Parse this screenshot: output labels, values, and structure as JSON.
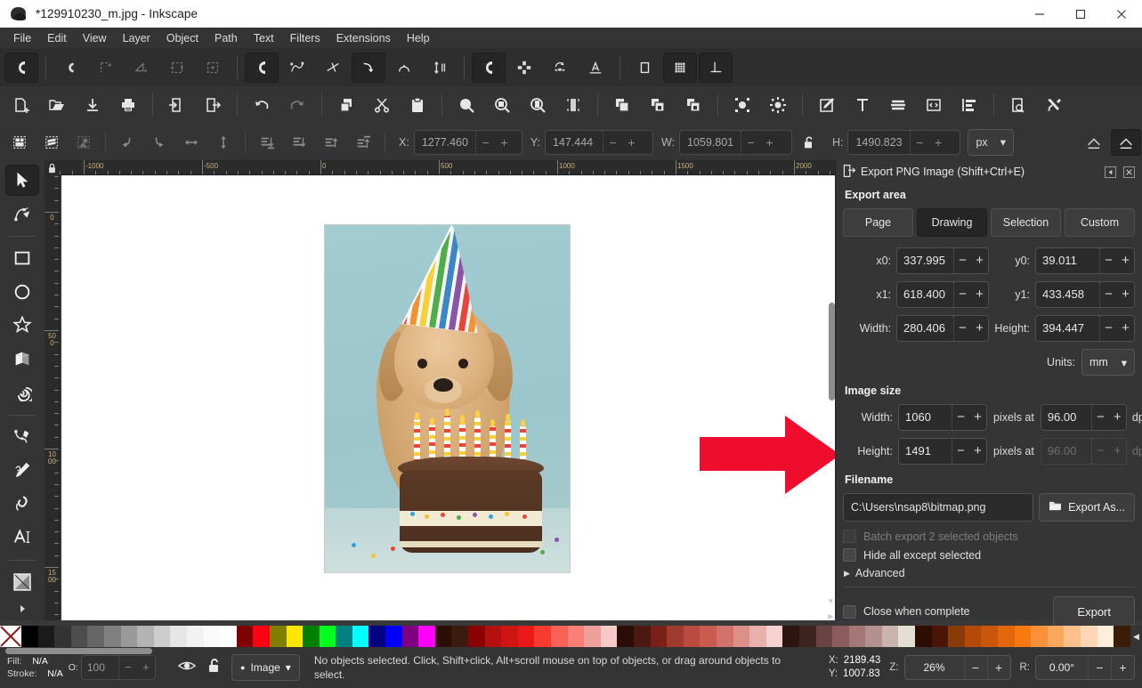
{
  "window": {
    "title": "*129910230_m.jpg - Inkscape",
    "app_icon": "inkscape-logo-icon",
    "minimize": "minimize-icon",
    "maximize": "maximize-icon",
    "close": "close-icon"
  },
  "menubar": {
    "items": [
      "File",
      "Edit",
      "View",
      "Layer",
      "Object",
      "Path",
      "Text",
      "Filters",
      "Extensions",
      "Help"
    ]
  },
  "snap_toolbar": {
    "buttons": [
      {
        "name": "enable-snapping",
        "icon": "magnet-icon",
        "active": true,
        "enabled": true
      },
      {
        "name": "snap-bounding-boxes",
        "icon": "magnet-bbox-icon",
        "active": false,
        "enabled": true
      },
      {
        "name": "snap-bbox-edges",
        "icon": "bbox-edge-icon",
        "active": false,
        "enabled": false
      },
      {
        "name": "snap-bbox-corners",
        "icon": "bbox-corner-icon",
        "active": false,
        "enabled": false
      },
      {
        "name": "snap-bbox-edge-midpoints",
        "icon": "bbox-edge-mid-icon",
        "active": false,
        "enabled": false
      },
      {
        "name": "snap-bbox-centers",
        "icon": "bbox-center-icon",
        "active": false,
        "enabled": false
      },
      {
        "name": "snap-nodes-paths",
        "icon": "magnet-node-icon",
        "active": true,
        "enabled": true
      },
      {
        "name": "snap-paths",
        "icon": "snap-path-icon",
        "active": false,
        "enabled": true
      },
      {
        "name": "snap-path-intersections",
        "icon": "snap-intersection-icon",
        "active": false,
        "enabled": true
      },
      {
        "name": "snap-cusp-nodes",
        "icon": "snap-cusp-icon",
        "active": true,
        "enabled": true
      },
      {
        "name": "snap-smooth-nodes",
        "icon": "snap-smooth-icon",
        "active": false,
        "enabled": true
      },
      {
        "name": "snap-midpoints",
        "icon": "snap-midpoint-icon",
        "active": false,
        "enabled": true
      },
      {
        "name": "snap-others",
        "icon": "magnet-other-icon",
        "active": true,
        "enabled": true
      },
      {
        "name": "snap-object-centers",
        "icon": "object-center-icon",
        "active": false,
        "enabled": true
      },
      {
        "name": "snap-rotation-centers",
        "icon": "rotation-center-icon",
        "active": false,
        "enabled": true
      },
      {
        "name": "snap-text-baselines",
        "icon": "text-baseline-icon",
        "active": false,
        "enabled": true
      },
      {
        "name": "snap-page-border",
        "icon": "page-border-icon",
        "active": false,
        "enabled": true
      },
      {
        "name": "snap-grids",
        "icon": "grid-icon",
        "active": true,
        "enabled": true
      },
      {
        "name": "snap-guides",
        "icon": "guide-icon",
        "active": true,
        "enabled": true
      }
    ]
  },
  "command_toolbar": {
    "buttons": [
      {
        "name": "new-document",
        "icon": "new-file-icon"
      },
      {
        "name": "open-document",
        "icon": "open-folder-icon"
      },
      {
        "name": "save-document",
        "icon": "save-icon"
      },
      {
        "name": "print-document",
        "icon": "print-icon"
      },
      {
        "name": "import",
        "icon": "import-icon"
      },
      {
        "name": "export",
        "icon": "export-icon"
      },
      {
        "name": "undo",
        "icon": "undo-arrow-icon"
      },
      {
        "name": "redo",
        "icon": "redo-arrow-icon",
        "dim": true
      },
      {
        "name": "copy",
        "icon": "copy-icon"
      },
      {
        "name": "cut",
        "icon": "scissors-icon"
      },
      {
        "name": "paste",
        "icon": "clipboard-icon"
      },
      {
        "name": "zoom-selection",
        "icon": "zoom-selection-icon"
      },
      {
        "name": "zoom-drawing",
        "icon": "zoom-drawing-icon"
      },
      {
        "name": "zoom-page",
        "icon": "zoom-page-icon"
      },
      {
        "name": "zoom-page-width",
        "icon": "zoom-width-icon"
      },
      {
        "name": "duplicate",
        "icon": "duplicate-icon"
      },
      {
        "name": "group",
        "icon": "group-icon"
      },
      {
        "name": "ungroup",
        "icon": "ungroup-icon"
      },
      {
        "name": "fill-stroke-dialog",
        "icon": "fill-stroke-icon"
      },
      {
        "name": "object-properties",
        "icon": "object-props-icon"
      },
      {
        "name": "xml-pen",
        "icon": "edit-pen-icon"
      },
      {
        "name": "text-tool-dialog",
        "icon": "text-T-icon"
      },
      {
        "name": "align-lines",
        "icon": "lines-icon"
      },
      {
        "name": "xml-editor",
        "icon": "xml-editor-icon"
      },
      {
        "name": "align-distribute",
        "icon": "align-icon"
      },
      {
        "name": "document-properties",
        "icon": "document-props-icon"
      },
      {
        "name": "preferences",
        "icon": "tools-icon"
      }
    ]
  },
  "select_toolbar": {
    "buttons": [
      {
        "name": "select-all",
        "icon": "select-all-icon",
        "dim": false
      },
      {
        "name": "select-all-layers",
        "icon": "select-layers-icon",
        "dim": false
      },
      {
        "name": "deselect",
        "icon": "deselect-icon",
        "dim": true
      },
      {
        "name": "rotate-ccw",
        "icon": "rotate-ccw-icon",
        "dim": true
      },
      {
        "name": "rotate-cw",
        "icon": "rotate-cw-icon",
        "dim": true
      },
      {
        "name": "flip-horizontal",
        "icon": "flip-horizontal-icon",
        "dim": true
      },
      {
        "name": "flip-vertical",
        "icon": "flip-vertical-icon",
        "dim": true
      },
      {
        "name": "lower-to-bottom",
        "icon": "lower-bottom-icon",
        "dim": true
      },
      {
        "name": "lower-one-step",
        "icon": "lower-step-icon",
        "dim": true
      },
      {
        "name": "raise-one-step",
        "icon": "raise-step-icon",
        "dim": true
      },
      {
        "name": "raise-to-top",
        "icon": "raise-top-icon",
        "dim": true
      }
    ],
    "fields": [
      {
        "name": "x-field",
        "label": "X:",
        "value": "1277.460"
      },
      {
        "name": "y-field",
        "label": "Y:",
        "value": "147.444"
      },
      {
        "name": "w-field",
        "label": "W:",
        "value": "1059.801"
      },
      {
        "name": "h-field",
        "label": "H:",
        "value": "1490.823"
      }
    ],
    "lock_icon": "unlocked-padlock-icon",
    "units": "px",
    "affect_buttons": [
      {
        "name": "scale-stroke-width",
        "icon": "stroke-scale-icon",
        "active": false
      },
      {
        "name": "move-gradients",
        "icon": "gradient-move-icon",
        "active": true
      }
    ],
    "overflow": "chevron-down-icon"
  },
  "toolbox": {
    "tools": [
      {
        "name": "selector-tool",
        "icon": "arrow-cursor-icon",
        "active": true
      },
      {
        "name": "node-tool",
        "icon": "node-editor-icon",
        "active": false
      },
      {
        "name": "rectangle-tool",
        "icon": "square-icon",
        "active": false
      },
      {
        "name": "ellipse-tool",
        "icon": "circle-icon",
        "active": false
      },
      {
        "name": "star-tool",
        "icon": "star-icon",
        "active": false
      },
      {
        "name": "box3d-tool",
        "icon": "cube-3d-icon",
        "active": false
      },
      {
        "name": "spiral-tool",
        "icon": "spiral-icon",
        "active": false
      },
      {
        "name": "bezier-tool",
        "icon": "bezier-pen-icon",
        "active": false
      },
      {
        "name": "pencil-tool",
        "icon": "pencil-icon",
        "active": false
      },
      {
        "name": "calligraphy-tool",
        "icon": "calligraphy-pen-icon",
        "active": false
      },
      {
        "name": "text-tool",
        "icon": "text-A-icon",
        "active": false
      },
      {
        "name": "gradient-tool",
        "icon": "gradient-square-icon",
        "active": false
      }
    ],
    "more_tools": "triangle-right-icon"
  },
  "rulers": {
    "horizontal_labels": [
      "-1000",
      "-500",
      "0",
      "500",
      "1000",
      "1500",
      "2000"
    ],
    "vertical_labels": [
      "0",
      "500",
      "1000",
      "1500"
    ],
    "lock_icon": "ruler-lock-icon"
  },
  "canvas": {
    "photo_alt": "dog-with-party-hat-and-birthday-cake-photo",
    "arrow_alt": "red-right-arrow-shape",
    "arrow_color": "#ee0d2c"
  },
  "export_dock": {
    "header": {
      "title": "Export PNG Image (Shift+Ctrl+E)",
      "icon": "export-png-icon",
      "collapse_icon": "collapse-left-icon",
      "close_icon": "close-panel-icon"
    },
    "export_area": {
      "section_title": "Export area",
      "tabs": [
        {
          "name": "area-tab-page",
          "label": "Page",
          "active": false
        },
        {
          "name": "area-tab-drawing",
          "label": "Drawing",
          "active": true
        },
        {
          "name": "area-tab-selection",
          "label": "Selection",
          "active": false
        },
        {
          "name": "area-tab-custom",
          "label": "Custom",
          "active": false
        }
      ],
      "fields": [
        {
          "name": "x0-field",
          "label": "x0:",
          "value": "337.995"
        },
        {
          "name": "y0-field",
          "label": "y0:",
          "value": "39.011"
        },
        {
          "name": "x1-field",
          "label": "x1:",
          "value": "618.400"
        },
        {
          "name": "y1-field",
          "label": "y1:",
          "value": "433.458"
        },
        {
          "name": "area-width-field",
          "label": "Width:",
          "value": "280.406"
        },
        {
          "name": "area-height-field",
          "label": "Height:",
          "value": "394.447"
        }
      ],
      "units_label": "Units:",
      "units_value": "mm"
    },
    "image_size": {
      "section_title": "Image size",
      "width_label": "Width:",
      "width_value": "1060",
      "height_label": "Height:",
      "height_value": "1491",
      "pixels_at": "pixels at",
      "dpi_width_value": "96.00",
      "dpi_height_value": "96.00",
      "dpi_label": "dpi"
    },
    "filename": {
      "section_title": "Filename",
      "value": "C:\\Users\\nsap8\\bitmap.png",
      "export_as_label": "Export As...",
      "folder_icon": "folder-icon"
    },
    "options": {
      "batch_label": "Batch export 2 selected objects",
      "batch_checked": false,
      "batch_disabled": true,
      "hide_label": "Hide all except selected",
      "hide_checked": false,
      "advanced_label": "Advanced",
      "advanced_expanded": false,
      "close_when_complete_label": "Close when complete",
      "close_when_complete_checked": false,
      "export_button_label": "Export"
    }
  },
  "palette": {
    "none_swatch": "no-color-x-icon",
    "scroll_icon": "palette-scroll-left-icon",
    "colors": [
      "#000000",
      "#1a1a1a",
      "#333333",
      "#4d4d4d",
      "#666666",
      "#808080",
      "#999999",
      "#b3b3b3",
      "#cccccc",
      "#e6e6e6",
      "#f2f2f2",
      "#fafafa",
      "#ffffff",
      "#800000",
      "#ff0013",
      "#808000",
      "#ffe600",
      "#008000",
      "#00ff1a",
      "#008080",
      "#00ffff",
      "#000080",
      "#0000ff",
      "#800080",
      "#ff00ff",
      "#2b0e06",
      "#3d1a10",
      "#8b0000",
      "#b41010",
      "#cf1414",
      "#e81a1a",
      "#f93a2f",
      "#fb6257",
      "#f98078",
      "#f0a09a",
      "#f6cac6",
      "#2a0d08",
      "#4a1a12",
      "#7a2018",
      "#a13a2e",
      "#bb4b3f",
      "#c95a4e",
      "#d1736a",
      "#dd9088",
      "#e8b1ab",
      "#f3d2cf",
      "#2c1410",
      "#3d2420",
      "#6a4444",
      "#8c5c5c",
      "#a57878",
      "#b49090",
      "#cbb4ac",
      "#e3ded6",
      "#2b0d03",
      "#4a1505",
      "#8a3a06",
      "#b34a08",
      "#c9560a",
      "#e2670c",
      "#f77a10",
      "#f9913a",
      "#fba85f",
      "#fcc08b",
      "#fdd7b5",
      "#feeedb",
      "#3a1c0a"
    ]
  },
  "statusbar": {
    "fill_label": "Fill:",
    "fill_value": "N/A",
    "stroke_label": "Stroke:",
    "stroke_value": "N/A",
    "opacity_label": "O:",
    "opacity_value": "100",
    "eye_icon": "eye-icon",
    "lock_icon": "unlocked-padlock-icon",
    "layer_name": "Image",
    "layer_caret": "chevron-down-icon",
    "message": "No objects selected. Click, Shift+click, Alt+scroll mouse on top of objects, or drag around objects to select.",
    "x_label": "X:",
    "x_value": "2189.43",
    "y_label": "Y:",
    "y_value": "1007.83",
    "zoom_label": "Z:",
    "zoom_value": "26%",
    "rotation_label": "R:",
    "rotation_value": "0.00°"
  }
}
